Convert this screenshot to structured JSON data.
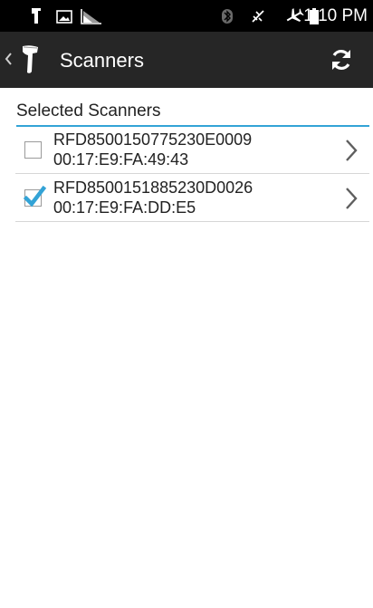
{
  "status_bar": {
    "time": "1:10 PM",
    "icons": [
      "scanner-notification-icon",
      "image-icon",
      "signal-chart-icon",
      "bluetooth-icon",
      "mute-icon",
      "airplane-mode-icon",
      "battery-icon"
    ]
  },
  "action_bar": {
    "title": "Scanners",
    "icons": [
      "back-chevron-icon",
      "scanner-app-icon",
      "refresh-icon"
    ]
  },
  "section": {
    "title": "Selected Scanners"
  },
  "scanners": [
    {
      "name": "RFD8500150775230E0009",
      "address": "00:17:E9:FA:49:43",
      "checked": false
    },
    {
      "name": "RFD8500151885230D0026",
      "address": "00:17:E9:FA:DD:E5",
      "checked": true
    }
  ],
  "colors": {
    "accent": "#33a3d6",
    "action_bar_bg": "#262626",
    "status_bar_bg": "#000000"
  }
}
